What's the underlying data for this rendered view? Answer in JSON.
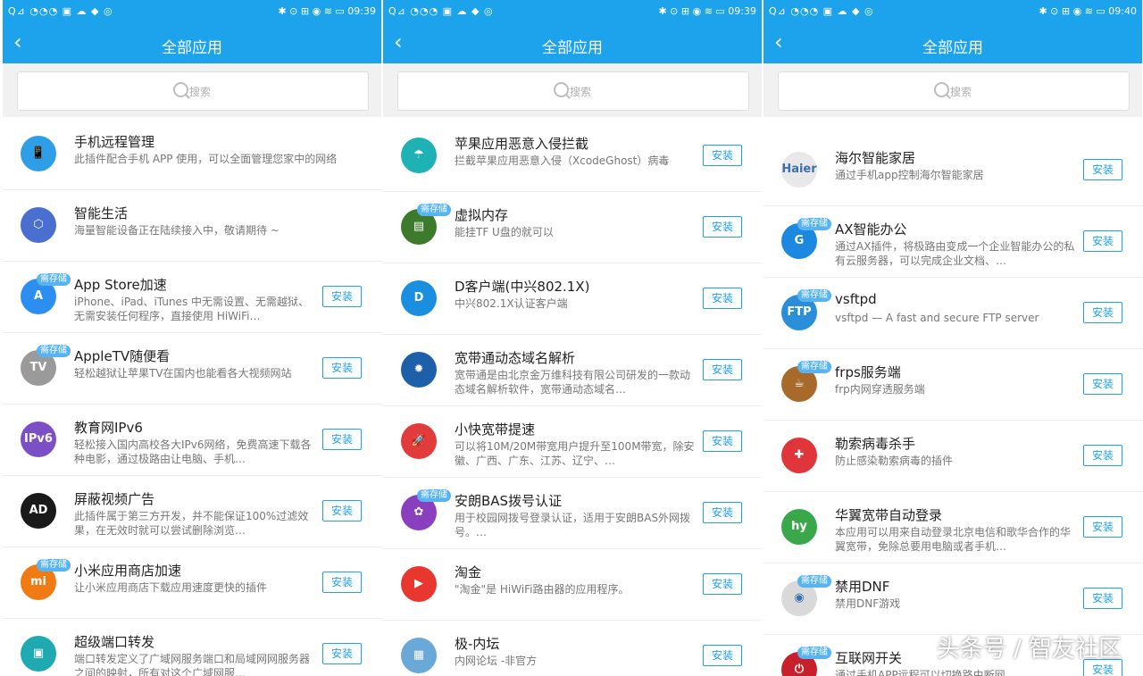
{
  "panels": [
    {
      "status": {
        "left": "Q⊿ ◔◔◔ ▣ ☁ ◆ ◎",
        "right": "✱ ⊙ ⊞ ◉ ≋ ▭ 09:39"
      },
      "title": "全部应用",
      "search_placeholder": "搜索",
      "items": [
        {
          "name": "手机远程管理",
          "desc": "此插件配合手机 APP 使用，可以全面管理您家中的网络",
          "icon_color": "#2e9ee6",
          "icon": "📱",
          "badge": "",
          "button": ""
        },
        {
          "name": "智能生活",
          "desc": "海量智能设备正在陆续接入中，敬请期待 ~",
          "icon_color": "#4a6fd0",
          "icon": "⬡",
          "badge": "",
          "button": ""
        },
        {
          "name": "App Store加速",
          "desc": "iPhone、iPad、iTunes 中无需设置、无需越狱、无需安装任何程序，直接使用 HiWiFi…",
          "icon_color": "#2b8ef0",
          "icon": "A",
          "badge": "需存储",
          "button": "安装"
        },
        {
          "name": "AppleTV随便看",
          "desc": "轻松越狱让苹果TV在国内也能看各大视频网站",
          "icon_color": "#9a9a9a",
          "icon": "TV",
          "badge": "需存储",
          "button": "安装"
        },
        {
          "name": "教育网IPv6",
          "desc": "轻松接入国内高校各大IPv6网络，免费高速下载各种电影，通过极路由让电脑、手机…",
          "icon_color": "#7b4fc5",
          "icon": "IPv6",
          "badge": "",
          "button": "安装"
        },
        {
          "name": "屏蔽视频广告",
          "desc": "此插件属于第三方开发，并不能保证100%过滤效果，在无效时就可以尝试删除浏览…",
          "icon_color": "#1a1a1a",
          "icon": "AD",
          "badge": "",
          "button": "安装"
        },
        {
          "name": "小米应用商店加速",
          "desc": "让小米应用商店下载应用速度更快的插件",
          "icon_color": "#f07a14",
          "icon": "mi",
          "badge": "需存储",
          "button": "安装"
        },
        {
          "name": "超级端口转发",
          "desc": "端口转发定义了广域网服务端口和局域网网服务器之间的映射，所有对这个广域网服…",
          "icon_color": "#1eaab0",
          "icon": "▣",
          "badge": "",
          "button": "安装"
        }
      ]
    },
    {
      "status": {
        "left": "Q⊿ ◔◔◔ ▣ ☁ ◆ ◎",
        "right": "✱ ⊙ ⊞ ◉ ≋ ▭ 09:39"
      },
      "title": "全部应用",
      "search_placeholder": "搜索",
      "items": [
        {
          "name": "苹果应用恶意入侵拦截",
          "desc": "拦截苹果应用恶意入侵（XcodeGhost）病毒",
          "icon_color": "#1eb2b5",
          "icon": "☂",
          "badge": "",
          "button": "安装"
        },
        {
          "name": "虚拟内存",
          "desc": "能挂TF U盘的就可以",
          "icon_color": "#3d7a2b",
          "icon": "▤",
          "badge": "需存储",
          "button": "安装"
        },
        {
          "name": "D客户端(中兴802.1X)",
          "desc": "中兴802.1X认证客户端",
          "icon_color": "#1a8fe0",
          "icon": "D",
          "badge": "",
          "button": "安装"
        },
        {
          "name": "宽带通动态域名解析",
          "desc": "宽带通是由北京金万维科技有限公司研发的一款动态域名解析软件，宽带通动态域名…",
          "icon_color": "#1d5fa8",
          "icon": "✹",
          "badge": "",
          "button": "安装"
        },
        {
          "name": "小快宽带提速",
          "desc": "可以将10M/20M带宽用户提升至100M带宽，除安徽、广西、广东、江苏、辽宁、…",
          "icon_color": "#e23b3b",
          "icon": "🚀",
          "badge": "",
          "button": "安装"
        },
        {
          "name": "安朗BAS拨号认证",
          "desc": "用于校园网拨号登录认证，适用于安朗BAS外网拨号。…",
          "icon_color": "#8a3fbf",
          "icon": "✿",
          "badge": "需存储",
          "button": "安装"
        },
        {
          "name": "淘金",
          "desc": "\"淘金\"是 HiWiFi路由器的应用程序。",
          "icon_color": "#e8372f",
          "icon": "▶",
          "badge": "",
          "button": "安装"
        },
        {
          "name": "极-内坛",
          "desc": "内网论坛 -非官方",
          "icon_color": "#6aa8d8",
          "icon": "▦",
          "badge": "",
          "button": "安装"
        }
      ]
    },
    {
      "status": {
        "left": "Q⊿ ◔◔◔ ▣ ☁ ◆ ◎",
        "right": "✱ ⊙ ⊞ ◉ ≋ ▭ 09:40"
      },
      "title": "全部应用",
      "search_placeholder": "搜索",
      "items": [
        {
          "name": "海尔智能家居",
          "desc": "通过手机app控制海尔智能家居",
          "icon_color": "#e8e8e8",
          "icon": "Haier",
          "badge": "",
          "button": "安装"
        },
        {
          "name": "AX智能办公",
          "desc": "通过AX插件，将极路由变成一个企业智能办公的私有云服务器，可以完成企业文档、…",
          "icon_color": "#1c88e0",
          "icon": "G",
          "badge": "需存储",
          "button": "安装"
        },
        {
          "name": "vsftpd",
          "desc": "vsftpd — A fast and secure FTP server",
          "icon_color": "#2a8ed8",
          "icon": "FTP",
          "badge": "需存储",
          "button": "安装"
        },
        {
          "name": "frps服务端",
          "desc": "frp内网穿透服务端",
          "icon_color": "#a86a2a",
          "icon": "☕",
          "badge": "需存储",
          "button": "安装"
        },
        {
          "name": "勒索病毒杀手",
          "desc": "防止感染勒索病毒的插件",
          "icon_color": "#e0353a",
          "icon": "✚",
          "badge": "",
          "button": "安装"
        },
        {
          "name": "华翼宽带自动登录",
          "desc": "本应用可以用来自动登录北京电信和歌华合作的华翼宽带，免除总要用电脑或者手机…",
          "icon_color": "#3aa84a",
          "icon": "hy",
          "badge": "",
          "button": "安装"
        },
        {
          "name": "禁用DNF",
          "desc": "禁用DNF游戏",
          "icon_color": "#d9d9d9",
          "icon": "◉",
          "badge": "需存储",
          "button": "安装"
        },
        {
          "name": "互联网开关",
          "desc": "通过手机APP远程可以切换路由断网、…",
          "icon_color": "#c8202a",
          "icon": "⏻",
          "badge": "需存储",
          "button": "安装"
        }
      ]
    }
  ],
  "watermark": "头条号 / 智友社区"
}
